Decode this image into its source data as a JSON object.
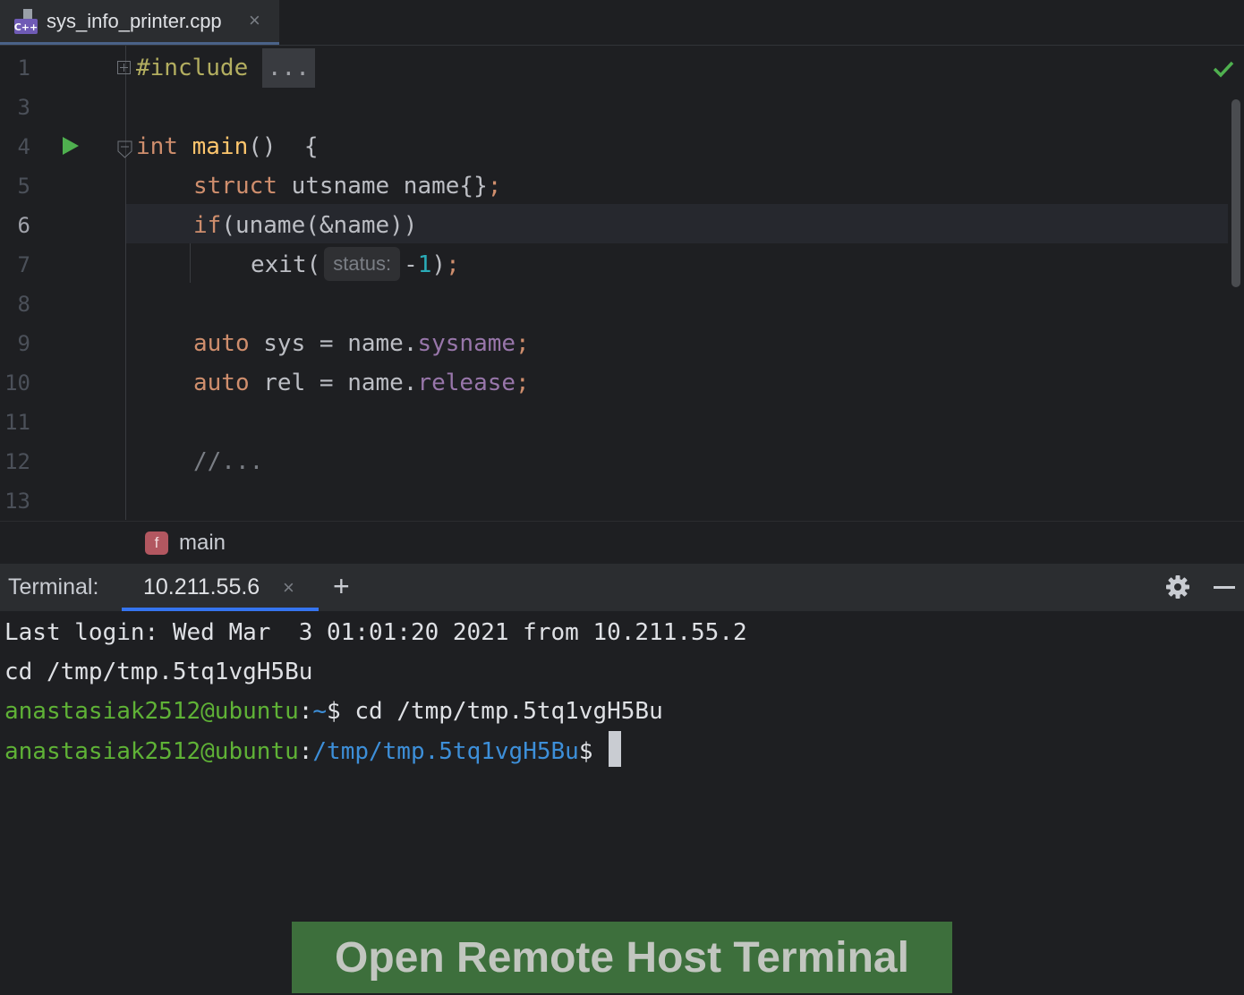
{
  "tab": {
    "file_name": "sys_info_printer.cpp",
    "close": "×",
    "icon_label": "C++"
  },
  "editor": {
    "lines": [
      {
        "n": "1",
        "include": "#include",
        "fold_placeholder": "..."
      },
      {
        "n": "3"
      },
      {
        "n": "4",
        "kw": "int",
        "fn": "main",
        "rest": "()  {"
      },
      {
        "n": "5",
        "kw": "struct",
        "rest": " utsname name{}",
        "semi": ";"
      },
      {
        "n": "6",
        "kw": "if",
        "rest": "(uname(&name))"
      },
      {
        "n": "7",
        "fn_call": "exit(",
        "hint": "status:",
        "minus": "-",
        "num": "1",
        "close": ")",
        "semi": ";"
      },
      {
        "n": "8"
      },
      {
        "n": "9",
        "kw": "auto",
        "rest": " sys = name.",
        "field": "sysname",
        "semi": ";"
      },
      {
        "n": "10",
        "kw": "auto",
        "rest": " rel = name.",
        "field": "release",
        "semi": ";"
      },
      {
        "n": "11"
      },
      {
        "n": "12",
        "comment": "//..."
      },
      {
        "n": "13"
      }
    ]
  },
  "breadcrumb": {
    "icon_letter": "f",
    "label": "main"
  },
  "terminal": {
    "title": "Terminal:",
    "tab_label": "10.211.55.6",
    "tab_close": "×",
    "add": "+",
    "lines": {
      "l1": "Last login: Wed Mar  3 01:01:20 2021 from 10.211.55.2",
      "l2": "cd /tmp/tmp.5tq1vgH5Bu",
      "l3_user": "anastasiak2512@ubuntu",
      "l3_colon": ":",
      "l3_path": "~",
      "l3_prompt": "$ cd /tmp/tmp.5tq1vgH5Bu",
      "l4_user": "anastasiak2512@ubuntu",
      "l4_colon": ":",
      "l4_path": "/tmp/tmp.5tq1vgH5Bu",
      "l4_prompt": "$ "
    }
  },
  "banner": {
    "label": "Open Remote Host Terminal"
  },
  "colors": {
    "keyword": "#cf8e6d",
    "function": "#ffc66d",
    "user": "#5fb236",
    "path": "#3d8fd9",
    "banner": "#3d6f3c",
    "accent": "#3574f0"
  }
}
